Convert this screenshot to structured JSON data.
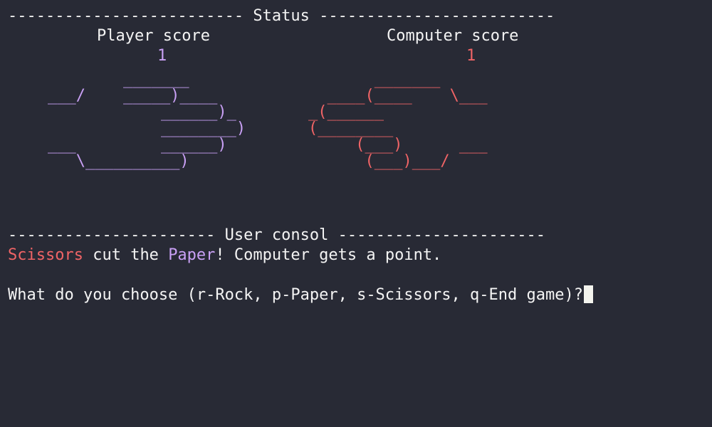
{
  "status_header": {
    "left_rule": "-------------------------",
    "title": "Status",
    "right_rule": "-------------------------"
  },
  "player": {
    "label": "Player score",
    "score": "1",
    "color": "#c9a0f5",
    "hand_ascii": "        _______\n___/    _____)____\n            ______)_\n            ________)\n___         ______)\n   \\__________)"
  },
  "computer": {
    "label": "Computer score",
    "score": "1",
    "color": "#f06466",
    "hand_ascii": "       _______\n  ____(____    \\___\n_(______\n(________\n     (___)      ___\n      (___)___/"
  },
  "console_header": {
    "left_rule": "----------------------",
    "title": "User consol",
    "right_rule": "----------------------"
  },
  "result": {
    "winner_word": "Scissors",
    "middle": " cut the ",
    "loser_word": "Paper",
    "tail": "! Computer gets a point."
  },
  "prompt": {
    "text": "What do you choose (r-Rock, p-Paper, s-Scissors, q-End game)?"
  },
  "colors": {
    "background": "#282a35",
    "text": "#f4f4f4",
    "player_accent": "#c9a0f5",
    "computer_accent": "#f06466"
  }
}
